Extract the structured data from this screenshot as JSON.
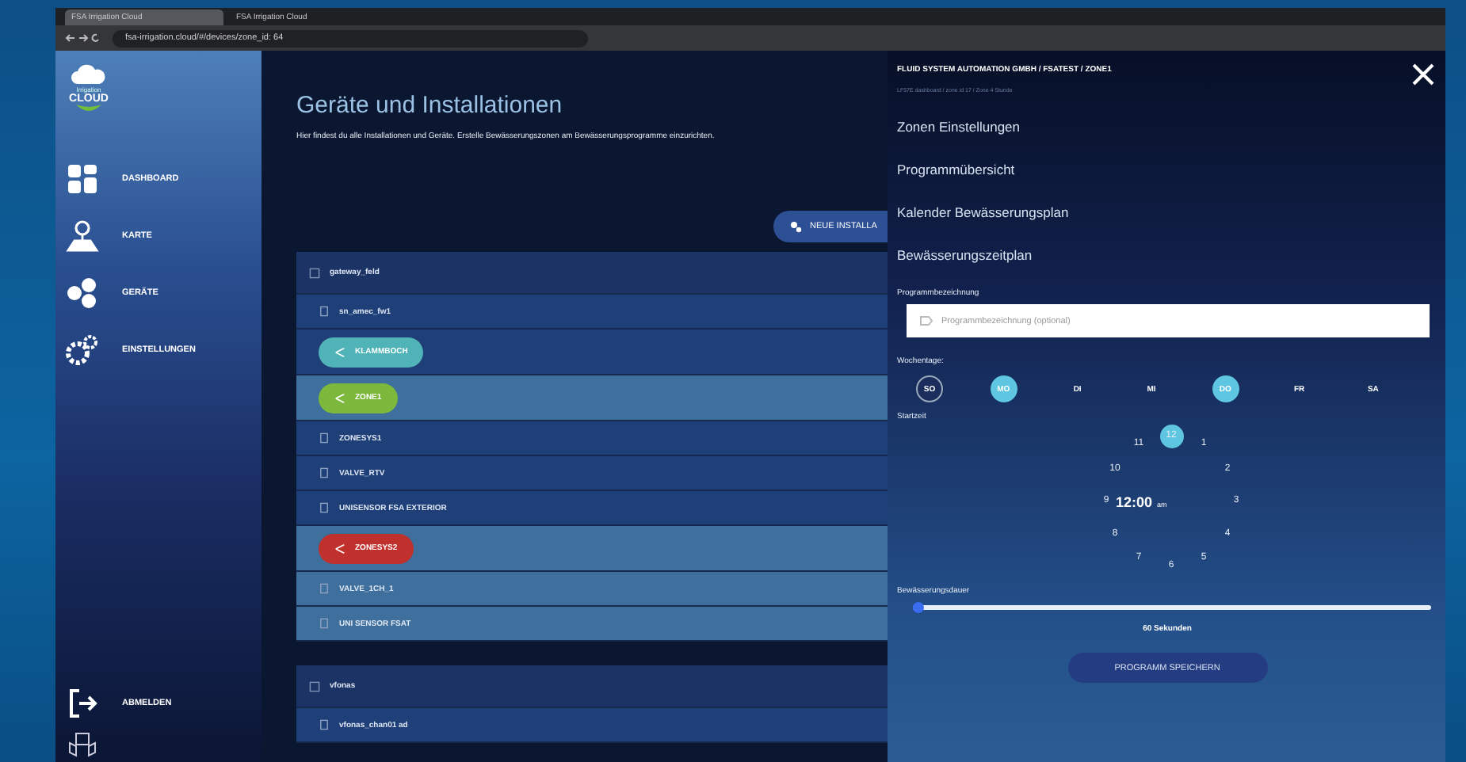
{
  "browser": {
    "tabs": [
      {
        "label": "FSA Irrigation Cloud",
        "selected": true
      },
      {
        "label": "FSA Irrigation Cloud",
        "selected": false
      }
    ],
    "address": "fsa-irrigation.cloud/#/devices/zone_id: 64"
  },
  "sidebar": {
    "logo": {
      "small": "Irrigation",
      "big": "CLOUD"
    },
    "items": [
      {
        "kind": "dashboard",
        "label": "DASHBOARD"
      },
      {
        "kind": "map",
        "label": "KARTE"
      },
      {
        "kind": "devices",
        "label": "GERÄTE"
      },
      {
        "kind": "settings",
        "label": "EINSTELLUNGEN"
      }
    ],
    "logout": "ABMELDEN"
  },
  "main": {
    "title": "Geräte und Installationen",
    "description": "Hier findest du alle Installationen und Geräte. Erstelle Bewässerungszonen am Bewässerungsprogramme einzurichten.",
    "new_button": "NEUE INSTALLA",
    "rows": [
      {
        "kind": "header",
        "label": "gateway_feld",
        "highlighted": false
      },
      {
        "kind": "device",
        "label": "sn_amec_fw1",
        "highlighted": false
      },
      {
        "kind": "pill",
        "label": "KLAMMBOCH",
        "color": "#4fb3b8",
        "highlighted": false
      },
      {
        "kind": "pill",
        "label": "ZONE1",
        "color": "#7cb83c",
        "highlighted": true
      },
      {
        "kind": "device",
        "label": "ZONESYS1",
        "highlighted": false
      },
      {
        "kind": "device",
        "label": "VALVE_RTV",
        "highlighted": false
      },
      {
        "kind": "device",
        "label": "UNISENSOR FSA EXTERIOR",
        "highlighted": false
      },
      {
        "kind": "pill",
        "label": "ZONESYS2",
        "color": "#c0312e",
        "highlighted": true
      },
      {
        "kind": "device",
        "label": "VALVE_1CH_1",
        "highlighted": true
      },
      {
        "kind": "device",
        "label": "UNI SENSOR FSAT",
        "highlighted": true
      },
      {
        "kind": "header",
        "label": "vfonas",
        "highlighted": false
      },
      {
        "kind": "device",
        "label": "vfonas_chan01 ad",
        "highlighted": false
      }
    ]
  },
  "drawer": {
    "breadcrumb": "FLUID SYSTEM AUTOMATION GMBH / FSATEST / ZONE1",
    "subtitle": "LF57E dashboard / zone id 17 / Zone 4 Stunde",
    "menu": [
      "Zonen Einstellungen",
      "Programmübersicht",
      "Kalender Bewässerungsplan",
      "Bewässerungszeitplan"
    ],
    "name_label": "Programmbezeichnung",
    "name_placeholder": "Programmbezeichnung (optional)",
    "days_label": "Wochentage:",
    "days": [
      {
        "label": "SO",
        "selected": false,
        "focused": true
      },
      {
        "label": "MO",
        "selected": true,
        "focused": false
      },
      {
        "label": "DI",
        "selected": false,
        "focused": false
      },
      {
        "label": "MI",
        "selected": false,
        "focused": false
      },
      {
        "label": "DO",
        "selected": true,
        "focused": false
      },
      {
        "label": "FR",
        "selected": false,
        "focused": false
      },
      {
        "label": "SA",
        "selected": false,
        "focused": false
      }
    ],
    "start_label": "Startzeit",
    "clock": {
      "hours": [
        {
          "label": "12",
          "selected": true
        },
        {
          "label": "1",
          "selected": false
        },
        {
          "label": "2",
          "selected": false
        },
        {
          "label": "3",
          "selected": false
        },
        {
          "label": "4",
          "selected": false
        },
        {
          "label": "5",
          "selected": false
        },
        {
          "label": "6",
          "selected": false
        },
        {
          "label": "7",
          "selected": false
        },
        {
          "label": "8",
          "selected": false
        },
        {
          "label": "9",
          "selected": false
        },
        {
          "label": "10",
          "selected": false
        },
        {
          "label": "11",
          "selected": false
        }
      ],
      "time": "12:00",
      "meridiem": "am"
    },
    "duration_label": "Bewässerungsdauer",
    "duration": {
      "level": 0.01
    },
    "duration_text": "60 Sekunden",
    "save": "PROGRAMM SPEICHERN"
  }
}
